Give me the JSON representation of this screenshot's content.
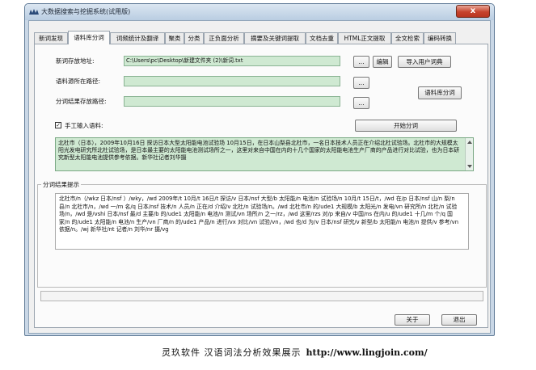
{
  "window": {
    "title": "大数据搜索与挖掘系统(试用版)",
    "close_label": "x"
  },
  "tabs": [
    {
      "label": "新词发现",
      "active": false
    },
    {
      "label": "语料库分词",
      "active": true
    },
    {
      "label": "词频统计及翻译",
      "active": false
    },
    {
      "label": "聚类",
      "active": false
    },
    {
      "label": "分类",
      "active": false
    },
    {
      "label": "正负面分析",
      "active": false
    },
    {
      "label": "摘要及关键词提取",
      "active": false
    },
    {
      "label": "文档去重",
      "active": false
    },
    {
      "label": "HTML正文提取",
      "active": false
    },
    {
      "label": "全文检索",
      "active": false
    },
    {
      "label": "编码转换",
      "active": false
    }
  ],
  "form": {
    "new_words_path_label": "新词存放地址:",
    "new_words_path_value": "C:\\Users\\pc\\Desktop\\新建文件夹 (2)\\新词.txt",
    "source_path_label": "语料源所在路径:",
    "source_path_value": "",
    "result_path_label": "分词结果存放路径:",
    "result_path_value": "",
    "browse_label": "...",
    "edit_label": "编辑",
    "import_dict_label": "导入用户词典",
    "corpus_segment_label": "语料库分词",
    "manual_input_label": "手工输入语料:",
    "manual_input_checked": true,
    "start_segment_label": "开始分词"
  },
  "input_text": "北杜市（日本），2009年10月16日 探访日本大型太阳能电池试验场 10月15日，在日本山梨县北杜市，一名日本技术人员正在介绍北杜试验场。北杜市的大规模太阳光发电研究所北杜试验场，是日本最主要的太阳能电池测试场所之一，这里对来自中国在内的十几个国家的太阳能电池生产厂商的产品进行对比试验，也为日本研究新型太阳能电池提供参考依据。新华社记者刘华摄",
  "result_group": {
    "legend": "分词结果提示",
    "text": "北杜市/n（/wkz 日本/nsf ）/wky，/wd 2009年/t 10月/t 16日/t 探访/v 日本/nsf 大型/b 太阳能/n 电池/n 试验场/n 10月/t 15日/t，/wd 在/p 日本/nsf 山/n 梨/n 县/n 北杜市/n，/wd 一/m 名/q 日本/nsf 技术/n 人员/n 正在/d 介绍/v 北杜/n 试验场/n。/wd 北杜市/n 的/ude1 大规模/b 太阳光/n 发电/vn 研究所/n 北杜/n 试验场/n，/wd 是/vshi 日本/nsf 最/d 主要/b 的/ude1 太阳能/n 电池/n 测试/vn 场所/n 之一/rz，/wd 这里/rzs 对/p 来自/v 中国/ns 在内/u 的/ude1 十几/m 个/q 国家/n 的/ude1 太阳能/n 电池/n 生产/vn 厂商/n 的/ude1 产品/n 进行/vx 对比/vn 试验/vn，/wd 也/d 为/v 日本/nsf 研究/v 新型/b 太阳能/n 电池/n 提供/v 参考/vn 依据/n。/wj 新华社/nt 记者/n 刘华/nr 摄/vg"
  },
  "footer": {
    "about_label": "关于",
    "exit_label": "退出"
  },
  "caption": {
    "text": "灵玖软件 汉语词法分析效果展示",
    "url": "http://www.lingjoin.com/"
  }
}
